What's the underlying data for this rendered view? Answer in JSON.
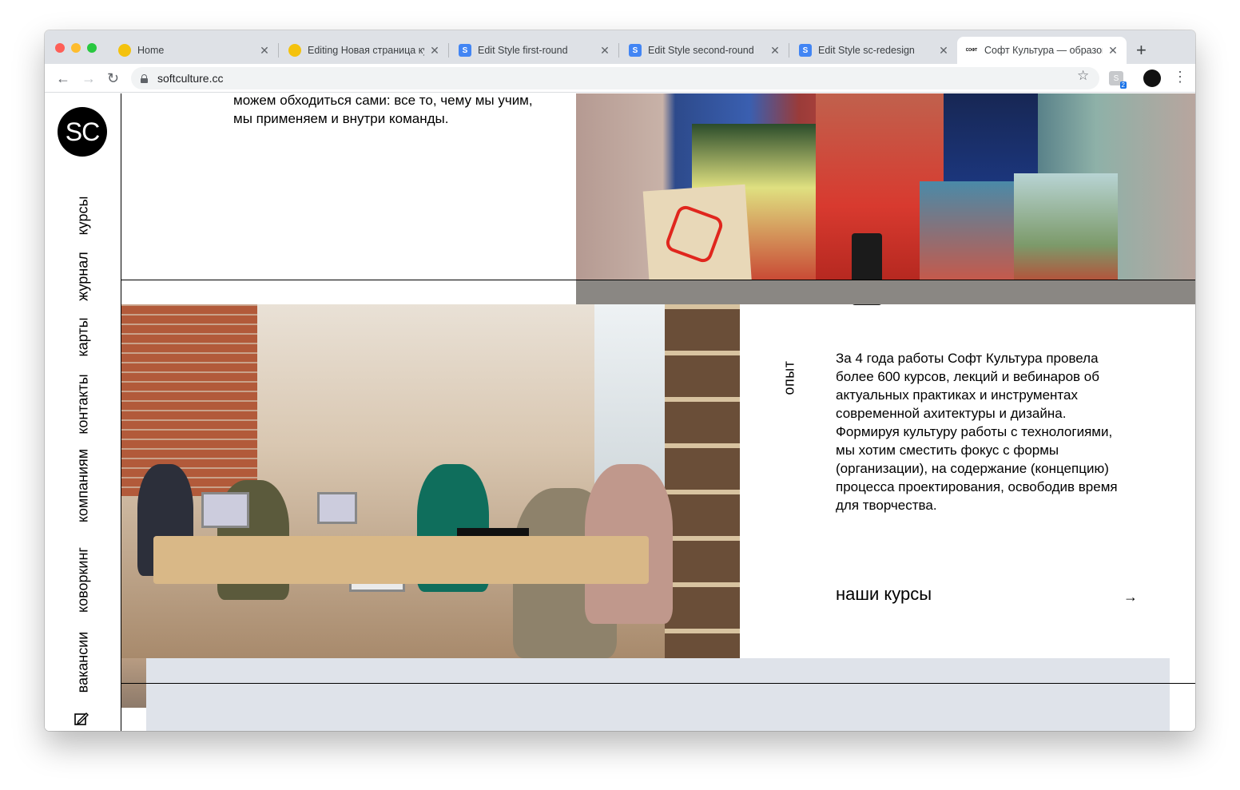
{
  "browser": {
    "tabs": [
      {
        "title": "Home",
        "favicon": "brand-favicon",
        "favicon_color": "#f4c20d"
      },
      {
        "title": "Editing Новая страница ку",
        "favicon": "brand-favicon",
        "favicon_color": "#f4c20d"
      },
      {
        "title": "Edit Style first-round",
        "favicon": "s-favicon",
        "favicon_color": "#4285f4"
      },
      {
        "title": "Edit Style second-round",
        "favicon": "s-favicon",
        "favicon_color": "#4285f4"
      },
      {
        "title": "Edit Style sc-redesign",
        "favicon": "s-favicon",
        "favicon_color": "#4285f4"
      },
      {
        "title": "Софт Культура — образова",
        "favicon": "softculture-favicon",
        "active": true
      }
    ],
    "url": "softculture.cc",
    "extension_badge": "2"
  },
  "site": {
    "logo": "SC",
    "nav": [
      "курсы",
      "журнал",
      "карты",
      "контакты",
      "компаниям",
      "коворкинг",
      "вакансии"
    ],
    "intro_text": "можем обходиться сами: все то, чему мы учим, мы применяем и внутри команды.",
    "experience": {
      "label": "опыт",
      "text": "За 4 года работы Софт Культура провела более 600 курсов, лекций и вебинаров об актуальных практиках и инструментах современной ахитектуры и дизайна. Формируя культуру работы с технологиями, мы хотим сместить фокус с формы (организации), на содержание (концепцию) процесса проектирования, освободив время для творчества.",
      "cta": "наши курсы",
      "cta_icon": "arrow-right-icon"
    }
  },
  "colors": {
    "accent_grey": "#dfe3ea",
    "tabbar": "#dee1e6"
  }
}
